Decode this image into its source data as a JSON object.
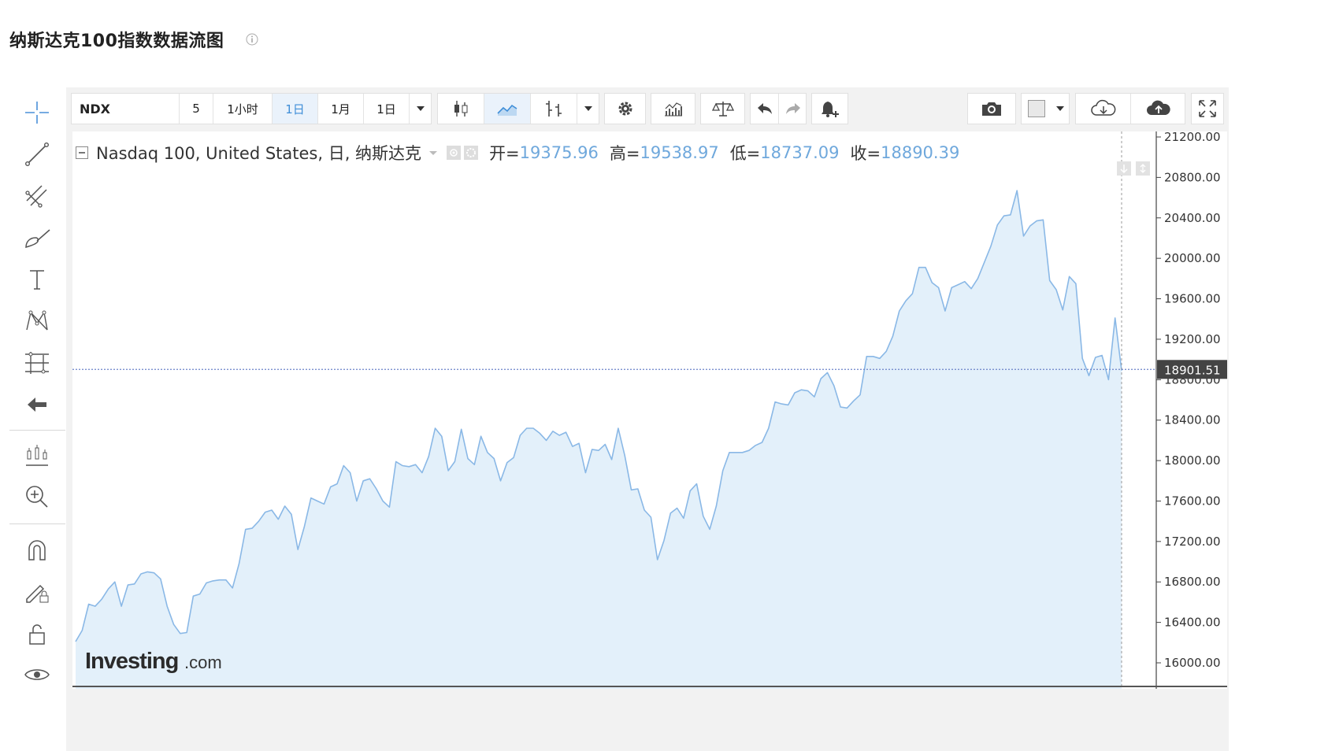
{
  "page": {
    "title": "纳斯达克100指数数据流图"
  },
  "toolbar": {
    "symbol": "NDX",
    "intervals": [
      {
        "label": "5"
      },
      {
        "label": "1小时"
      },
      {
        "label": "1日",
        "active": true
      },
      {
        "label": "1月"
      },
      {
        "label": "1日"
      }
    ]
  },
  "legend": {
    "name": "Nasdaq 100, United States, 日, 纳斯达克",
    "open_label": "开=",
    "open": "19375.96",
    "high_label": "高=",
    "high": "19538.97",
    "low_label": "低=",
    "low": "18737.09",
    "close_label": "收=",
    "close": "18890.39"
  },
  "watermark": {
    "brand": "Investing",
    "suffix": ".com"
  },
  "colors": {
    "line": "#8ab8e6",
    "fill": "#e3f0fa",
    "price_tag": "#444444",
    "accent": "#3f8ed8"
  },
  "chart_data": {
    "type": "area",
    "title": "",
    "xlabel": "",
    "ylabel": "",
    "ylim": [
      15800,
      21300
    ],
    "y_ticks": [
      "21200.00",
      "20800.00",
      "20400.00",
      "20000.00",
      "19600.00",
      "19200.00",
      "18800.00",
      "18400.00",
      "18000.00",
      "17600.00",
      "17200.00",
      "16800.00",
      "16400.00",
      "16000.00"
    ],
    "y_tick_values": [
      21200,
      20800,
      20400,
      20000,
      19600,
      19200,
      18800,
      18400,
      18000,
      17600,
      17200,
      16800,
      16400,
      16000
    ],
    "current_price": 18901.51,
    "current_price_label": "18901.51",
    "values": [
      16210,
      16320,
      16580,
      16560,
      16630,
      16730,
      16800,
      16560,
      16770,
      16780,
      16880,
      16900,
      16890,
      16830,
      16560,
      16380,
      16290,
      16300,
      16660,
      16680,
      16790,
      16810,
      16820,
      16820,
      16740,
      16980,
      17320,
      17330,
      17400,
      17490,
      17510,
      17420,
      17550,
      17470,
      17120,
      17350,
      17630,
      17600,
      17570,
      17740,
      17770,
      17950,
      17880,
      17600,
      17800,
      17820,
      17720,
      17600,
      17540,
      17990,
      17950,
      17940,
      17960,
      17880,
      18040,
      18320,
      18240,
      17900,
      17990,
      18310,
      18020,
      17960,
      18240,
      18080,
      18020,
      17800,
      17980,
      18030,
      18250,
      18320,
      18320,
      18270,
      18200,
      18290,
      18250,
      18280,
      18140,
      18170,
      17880,
      18110,
      18100,
      18160,
      18010,
      18320,
      18050,
      17710,
      17720,
      17510,
      17440,
      17020,
      17210,
      17480,
      17530,
      17430,
      17700,
      17770,
      17450,
      17320,
      17550,
      17900,
      18080,
      18080,
      18080,
      18100,
      18150,
      18180,
      18320,
      18580,
      18560,
      18550,
      18670,
      18700,
      18690,
      18630,
      18810,
      18870,
      18740,
      18530,
      18520,
      18590,
      18650,
      19030,
      19030,
      19010,
      19080,
      19230,
      19480,
      19580,
      19650,
      19910,
      19910,
      19760,
      19710,
      19480,
      19710,
      19740,
      19770,
      19700,
      19800,
      19960,
      20120,
      20330,
      20420,
      20430,
      20670,
      20220,
      20320,
      20370,
      20380,
      19780,
      19690,
      19490,
      19820,
      19750,
      19010,
      18840,
      19020,
      19040,
      18800,
      19410,
      18890
    ]
  }
}
